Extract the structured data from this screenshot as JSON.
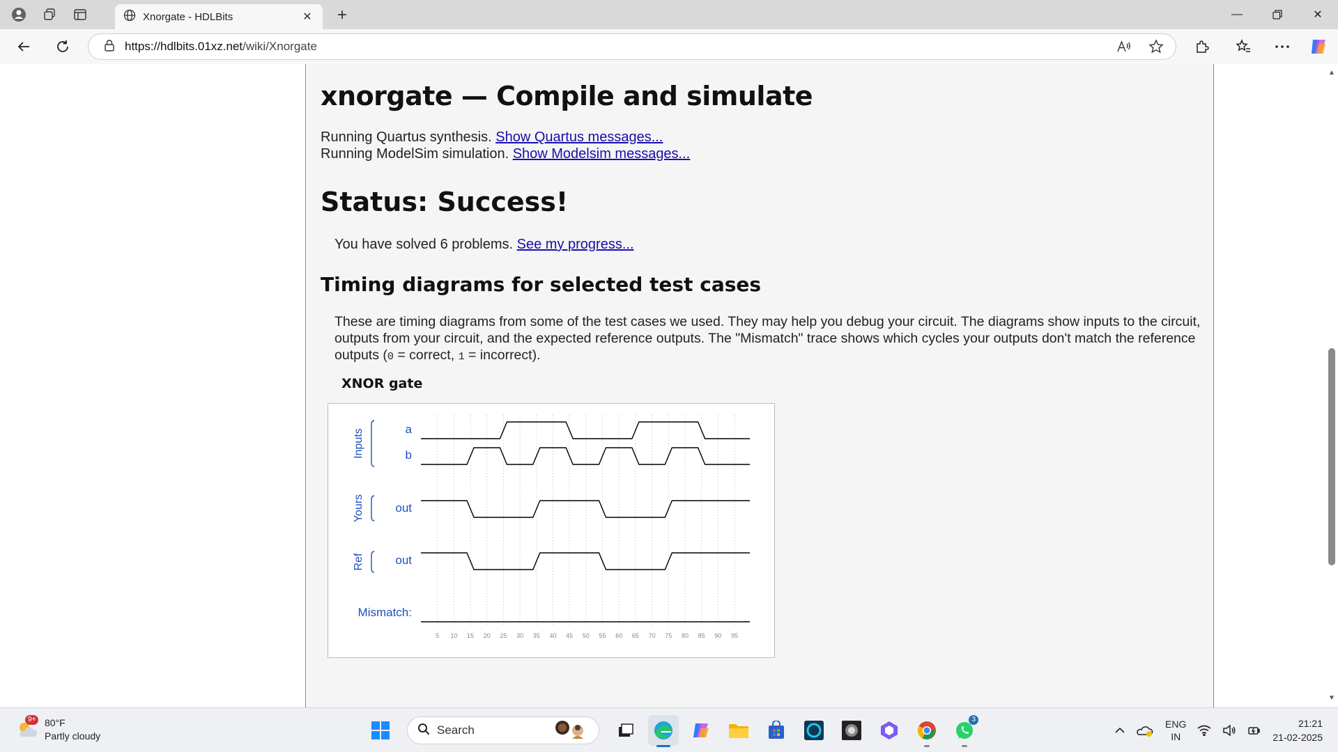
{
  "browser": {
    "tab_title": "Xnorgate - HDLBits",
    "url_host": "https://hdlbits.01xz.net",
    "url_path": "/wiki/Xnorgate"
  },
  "page": {
    "heading": "xnorgate — Compile and simulate",
    "quartus_text": "Running Quartus synthesis. ",
    "quartus_link": "Show Quartus messages...",
    "modelsim_text": "Running ModelSim simulation. ",
    "modelsim_link": "Show Modelsim messages...",
    "status": "Status: Success!",
    "solved_text": "You have solved 6 problems. ",
    "progress_link": "See my progress...",
    "timing_heading": "Timing diagrams for selected test cases",
    "desc_part1": "These are timing diagrams from some of the test cases we used. They may help you debug your circuit. The diagrams show inputs to the circuit, outputs from your circuit, and the expected reference outputs. The \"Mismatch\" trace shows which cycles your outputs don't match the reference outputs (",
    "desc_code0": "0",
    "desc_part2": " = correct, ",
    "desc_code1": "1",
    "desc_part3": " = incorrect).",
    "chart_title": "XNOR gate"
  },
  "chart_data": {
    "type": "timing",
    "title": "XNOR gate",
    "groups": [
      {
        "name": "Inputs",
        "signals": [
          "a",
          "b"
        ]
      },
      {
        "name": "Yours",
        "signals": [
          "out"
        ]
      },
      {
        "name": "Ref",
        "signals": [
          "out"
        ]
      }
    ],
    "mismatch_label": "Mismatch:",
    "x_ticks": [
      5,
      10,
      15,
      20,
      25,
      30,
      35,
      40,
      45,
      50,
      55,
      60,
      65,
      70,
      75,
      80,
      85,
      90,
      95
    ],
    "x_range": [
      0,
      95
    ],
    "signals": [
      {
        "name": "a",
        "group": "Inputs",
        "steps": [
          [
            0,
            0
          ],
          [
            25,
            1
          ],
          [
            45,
            0
          ],
          [
            65,
            1
          ],
          [
            85,
            0
          ]
        ]
      },
      {
        "name": "b",
        "group": "Inputs",
        "steps": [
          [
            0,
            0
          ],
          [
            15,
            1
          ],
          [
            25,
            0
          ],
          [
            35,
            1
          ],
          [
            45,
            0
          ],
          [
            55,
            1
          ],
          [
            65,
            0
          ],
          [
            75,
            1
          ],
          [
            85,
            0
          ]
        ]
      },
      {
        "name": "out",
        "group": "Yours",
        "steps": [
          [
            0,
            1
          ],
          [
            15,
            0
          ],
          [
            35,
            1
          ],
          [
            55,
            0
          ],
          [
            75,
            1
          ]
        ]
      },
      {
        "name": "out",
        "group": "Ref",
        "steps": [
          [
            0,
            1
          ],
          [
            15,
            0
          ],
          [
            35,
            1
          ],
          [
            55,
            0
          ],
          [
            75,
            1
          ]
        ]
      },
      {
        "name": "Mismatch",
        "group": "",
        "steps": [
          [
            0,
            0
          ]
        ]
      }
    ],
    "colors": {
      "label": "#1f4fbf",
      "trace": "#000000",
      "grid": "#bbbbbb"
    }
  },
  "taskbar": {
    "weather_temp": "80°F",
    "weather_desc": "Partly cloudy",
    "weather_badge": "9+",
    "search_placeholder": "Search",
    "whatsapp_badge": "3",
    "lang_top": "ENG",
    "lang_bottom": "IN",
    "time": "21:21",
    "date": "21-02-2025"
  }
}
